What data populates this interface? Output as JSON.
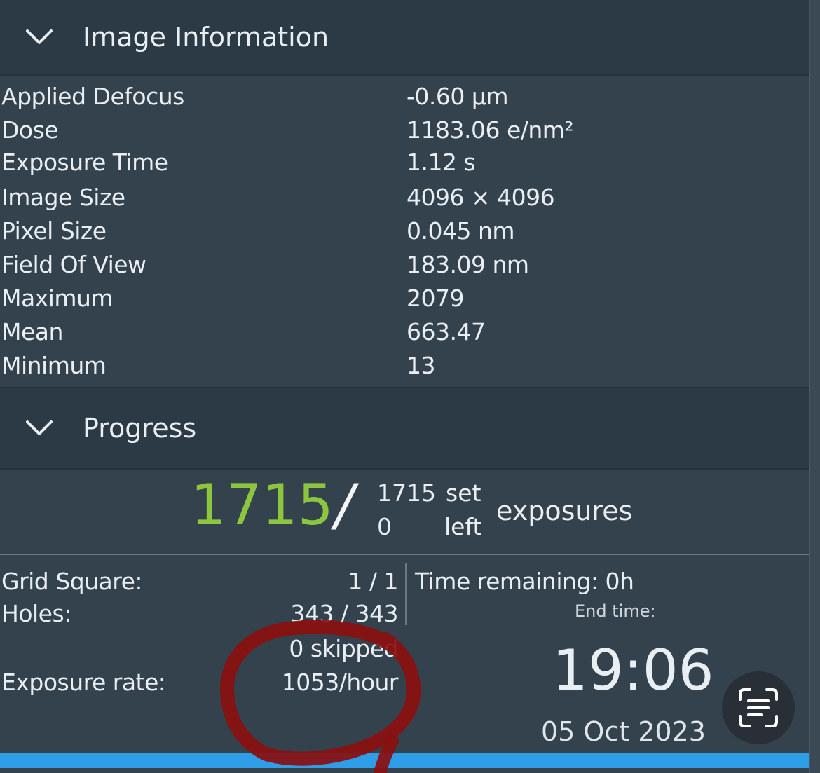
{
  "image_information": {
    "title": "Image Information",
    "rows": [
      {
        "label": "Applied Defocus",
        "value": "-0.60 µm"
      },
      {
        "label": "Dose",
        "value": "1183.06 e/nm²"
      },
      {
        "label": "Exposure Time",
        "value": "1.12 s"
      },
      {
        "label": "Image Size",
        "value": "4096 × 4096"
      },
      {
        "label": "Pixel Size",
        "value": "0.045 nm"
      },
      {
        "label": "Field Of View",
        "value": "183.09 nm"
      },
      {
        "label": "Maximum",
        "value": "2079"
      },
      {
        "label": "Mean",
        "value": "663.47"
      },
      {
        "label": "Minimum",
        "value": "13"
      }
    ]
  },
  "progress": {
    "title": "Progress",
    "completed": "1715",
    "slash": "/",
    "set_count": "1715",
    "left_count": "0",
    "set_word": "set",
    "left_word": "left",
    "unit_word": "exposures",
    "grid_square_label": "Grid Square:",
    "grid_square_value": "1 / 1",
    "holes_label": "Holes:",
    "holes_value": "343 / 343",
    "skipped_text": "0 skipped",
    "exposure_rate_label": "Exposure rate:",
    "exposure_rate_value": "1053/hour",
    "time_remaining": "Time remaining: 0h",
    "end_time_label": "End time:",
    "end_time": "19:06",
    "end_date": "05 Oct 2023",
    "bar_fraction": 1.0
  },
  "colors": {
    "completed_count": "#8cc63f",
    "progress_bar": "#2f9ee8",
    "annotation_ink": "#8b0f0f"
  },
  "icons": {
    "collapse": "chevron-down-icon",
    "scan": "scan-text-icon"
  }
}
